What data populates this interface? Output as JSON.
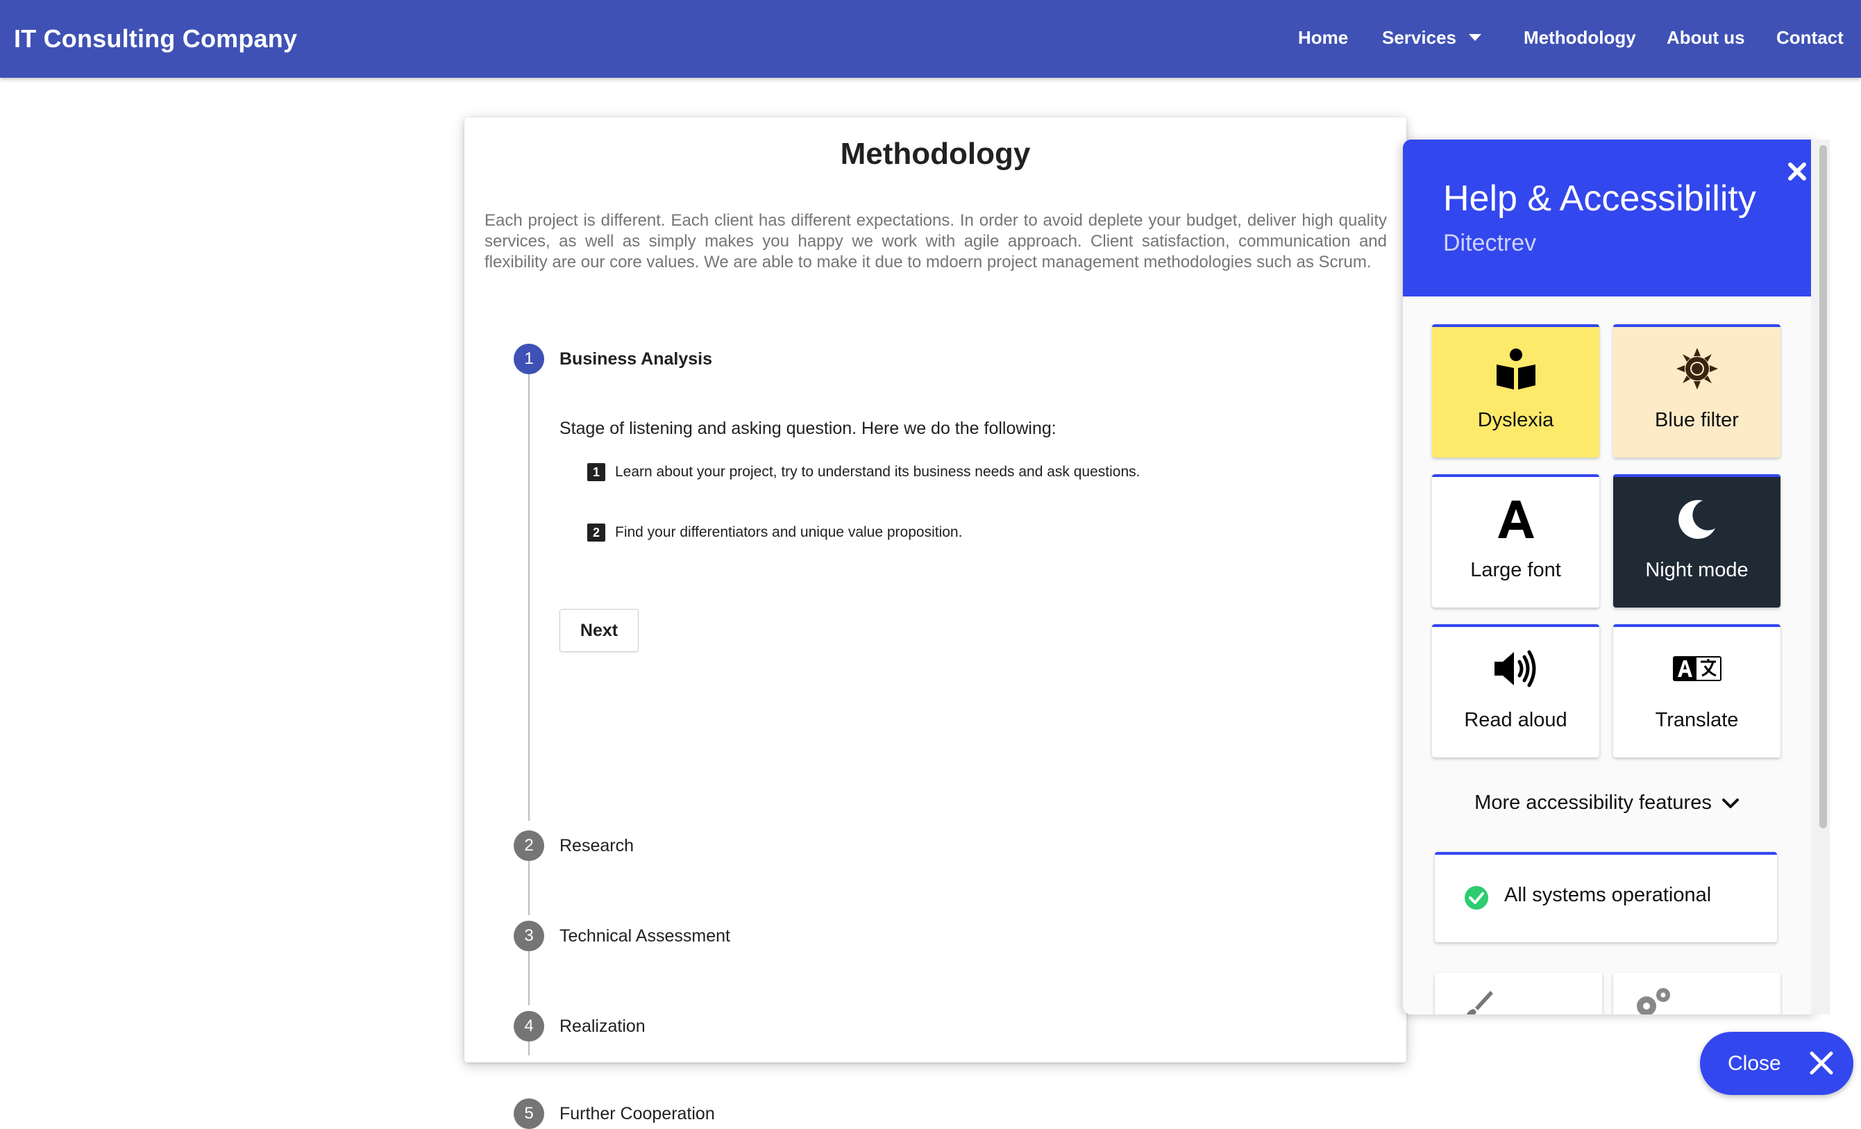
{
  "navbar": {
    "brand": "IT Consulting Company",
    "links": [
      {
        "label": "Home"
      },
      {
        "label": "Services",
        "has_dropdown": true
      },
      {
        "label": "Methodology"
      },
      {
        "label": "About us"
      },
      {
        "label": "Contact"
      }
    ],
    "background_color": "#3f51b5"
  },
  "methodology": {
    "title": "Methodology",
    "intro": "Each project is different. Each client has different expectations. In order to avoid deplete your budget, deliver high quality services, as well as simply makes you happy we work with agile approach. Client satisfaction, communication and flexibility are our core values. We are able to make it due to mdoern project management methodologies such as Scrum.",
    "steps": [
      {
        "number": "1",
        "label": "Business Analysis",
        "active": true
      },
      {
        "number": "2",
        "label": "Research"
      },
      {
        "number": "3",
        "label": "Technical Assessment"
      },
      {
        "number": "4",
        "label": "Realization"
      },
      {
        "number": "5",
        "label": "Further Cooperation"
      }
    ],
    "active_step": {
      "description": "Stage of listening and asking question. Here we do the following:",
      "items": [
        {
          "number": "1",
          "text": "Learn about your project, try to understand its business needs and ask questions."
        },
        {
          "number": "2",
          "text": "Find your differentiators and unique value proposition."
        }
      ],
      "next_label": "Next"
    },
    "active_color": "#3f51b5",
    "inactive_color": "#757575"
  },
  "accessibility_panel": {
    "title": "Help & Accessibility",
    "subtitle": "Ditectrev",
    "accent_color": "#3347ee",
    "tiles": [
      {
        "label": "Dyslexia",
        "icon": "reading-person-icon",
        "bg": "#fde96a"
      },
      {
        "label": "Blue filter",
        "icon": "sun-icon",
        "bg": "#fdebc8"
      },
      {
        "label": "Large font",
        "icon": "letter-a-icon",
        "bg": "#ffffff"
      },
      {
        "label": "Night mode",
        "icon": "moon-icon",
        "bg": "#1f2a35"
      },
      {
        "label": "Read aloud",
        "icon": "speaker-icon",
        "bg": "#ffffff"
      },
      {
        "label": "Translate",
        "icon": "translate-icon",
        "bg": "#ffffff"
      }
    ],
    "more_label": "More accessibility features",
    "status_text": "All systems operational",
    "status_color": "#2ecc71",
    "partial_tiles": [
      {
        "icon": "brush-icon"
      },
      {
        "icon": "gears-icon"
      }
    ]
  },
  "close_button": {
    "label": "Close"
  }
}
